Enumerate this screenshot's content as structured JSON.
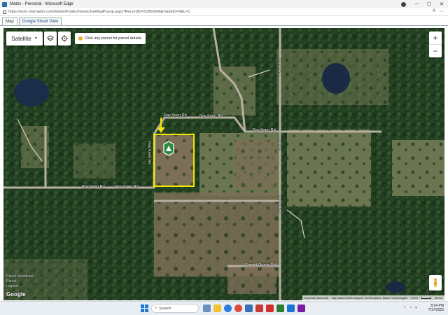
{
  "window": {
    "title": "Matrix - Personal - Microsoft Edge"
  },
  "browser": {
    "url": "https://eom.mlsmatrix.com/Matrix/Public/InteractiveMapPopup.aspx?RecordID=51859066&TableID=9&L=1"
  },
  "tabs": [
    {
      "label": "Map"
    },
    {
      "label": "Google Street View"
    }
  ],
  "map": {
    "type_label": "Satellite",
    "hint": "Click any parcel for parcel details.",
    "zoom_in": "+",
    "zoom_out": "−",
    "roads": {
      "ray_keen_1": "Ray Keen Rd",
      "ray_keen_2": "Ray Keen Rd",
      "ray_keen_3": "Ray Keen Rd",
      "ray_keen_4": "Ray Keen Rd",
      "ray_keen_vert": "Ray Keen Rd",
      "lonnell_1": "Lonnel Rd",
      "lonnell_2": "Lonnel Rd",
      "lonnell_3": "Lonnel Rd",
      "ronald_quave": "Ronald Quave Rd"
    },
    "disclaimer_1": "Parcel Disclaimer",
    "disclaimer_2": "Parcel",
    "disclaimer_3": "Legend",
    "google_logo": "Google",
    "attribution": {
      "shortcuts": "Keyboard shortcuts",
      "data": "Map data ©2025 Imagery ©2025 Airbus, Maxar Technologies",
      "scale": "200 ft",
      "terms": "Terms"
    }
  },
  "taskbar": {
    "search_placeholder": "Search",
    "time": "8:24 PM",
    "date": "7/17/2025"
  },
  "colors": {
    "parcel_outline": "#f2e600",
    "accent": "#1d78d8"
  }
}
